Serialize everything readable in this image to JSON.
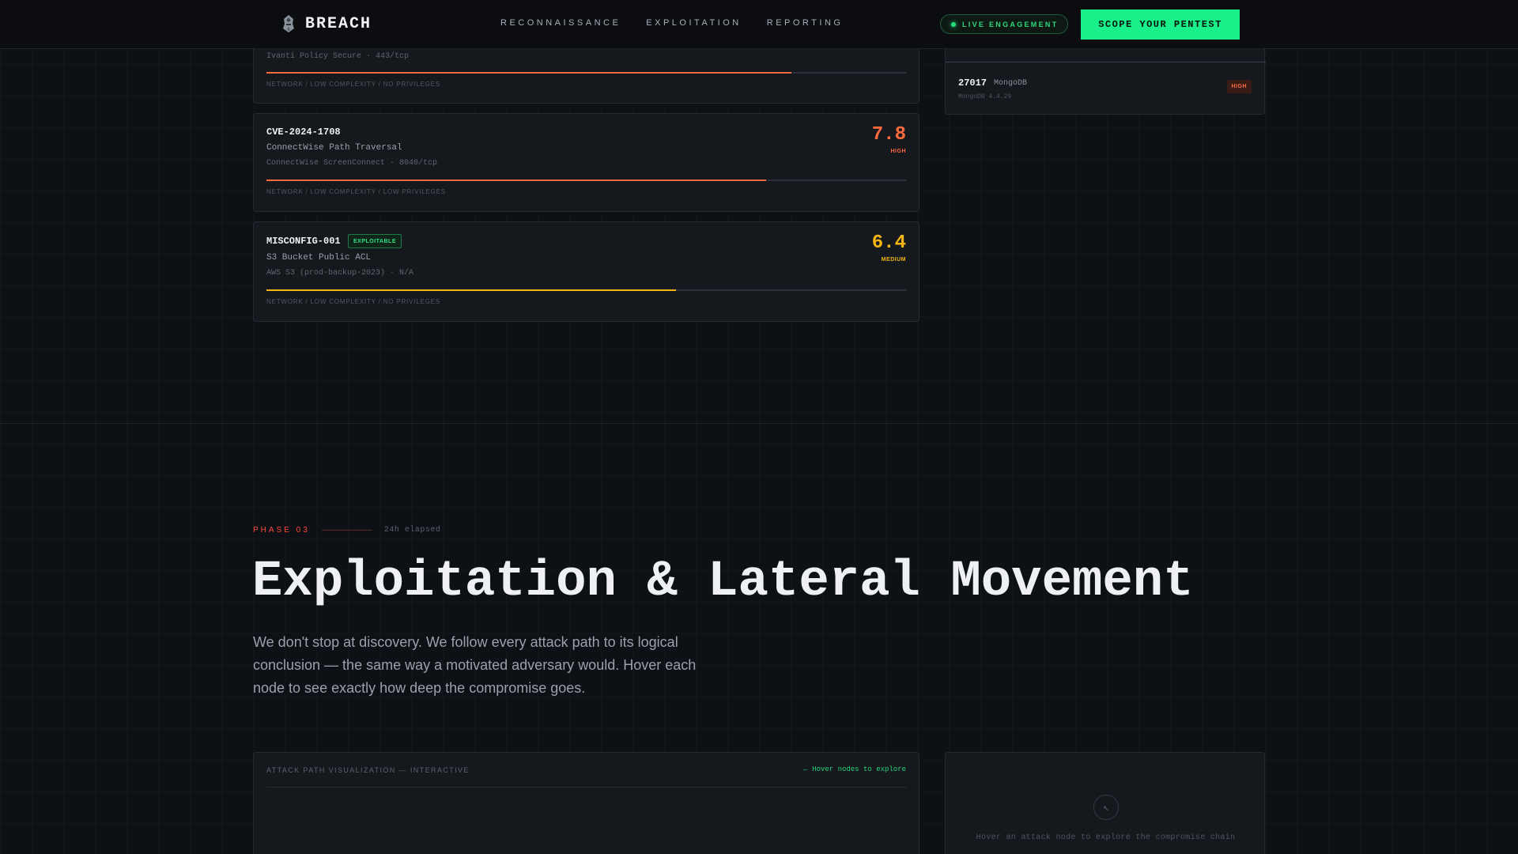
{
  "nav": {
    "logo_text": "BREACH",
    "links": [
      "RECONNAISSANCE",
      "EXPLOITATION",
      "REPORTING"
    ],
    "live_label": "LIVE ENGAGEMENT",
    "cta_label": "SCOPE YOUR PENTEST"
  },
  "cards": [
    {
      "target": "Ivanti Policy Secure · 443/tcp",
      "vector": "NETWORK / LOW COMPLEXITY / NO PRIVILEGES",
      "score_fill": 0.82,
      "color": "#ff6a3d"
    },
    {
      "id": "CVE-2024-1708",
      "title": "ConnectWise Path Traversal",
      "target": "ConnectWise ScreenConnect · 8040/tcp",
      "vector": "NETWORK / LOW COMPLEXITY / LOW PRIVILEGES",
      "score": "7.8",
      "severity": "HIGH",
      "score_fill": 0.78,
      "color": "#ff6a3d"
    },
    {
      "id": "MISCONFIG-001",
      "badge": "EXPLOITABLE",
      "title": "S3 Bucket Public ACL",
      "target": "AWS S3 (prod-backup-2023) · N/A",
      "vector": "NETWORK / LOW COMPLEXITY / NO PRIVILEGES",
      "score": "6.4",
      "severity": "MEDIUM",
      "score_fill": 0.64,
      "color": "#f5b614"
    }
  ],
  "port": {
    "number": "27017",
    "service": "MongoDB",
    "version": "MongoDB 4.4.29",
    "risk": "HIGH"
  },
  "phase": {
    "label": "PHASE 03",
    "elapsed": "24h elapsed",
    "title": "Exploitation & Lateral Movement",
    "description": "We don't stop at discovery. We follow every attack path to its logical conclusion — the same way a motivated adversary would. Hover each node to see exactly how deep the compromise goes."
  },
  "viz": {
    "title": "ATTACK PATH VISUALIZATION — INTERACTIVE",
    "hint": "← Hover nodes to explore",
    "detail_text": "Hover an attack node to explore the compromise chain"
  },
  "colors": {
    "accent": "#19f08a",
    "high": "#ff6a3d",
    "medium": "#f5b614",
    "phase": "#ff4a3d"
  }
}
